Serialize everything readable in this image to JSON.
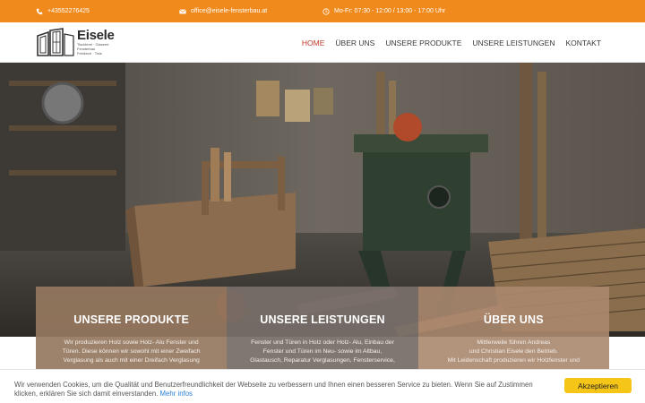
{
  "topbar": {
    "phone": "+43552276425",
    "email": "office@eisele-fensterbau.at",
    "hours": "Mo-Fr: 07:30 - 12:00 / 13:00 - 17:00 Uhr",
    "icons": [
      "phone-icon",
      "mail-icon",
      "clock-icon"
    ],
    "color": "#f08a1c"
  },
  "header": {
    "logo": {
      "name": "Eisele",
      "sub": [
        "Tischlerei · Glaserei",
        "Fensterbau",
        "Feldkirch · Tisis"
      ]
    },
    "nav": [
      {
        "label": "HOME",
        "active": true
      },
      {
        "label": "ÜBER UNS"
      },
      {
        "label": "UNSERE PRODUKTE"
      },
      {
        "label": "UNSERE LEISTUNGEN"
      },
      {
        "label": "KONTAKT"
      }
    ],
    "active_color": "#c0392b"
  },
  "boxes": [
    {
      "title": "UNSERE PRODUKTE",
      "lines": [
        "Wir produzieren Holz sowie Holz- Alu Fenster und",
        "Türen. Diese können wir sowohl mit einer Zweifach",
        "Verglasung als auch mit einer Dreifach Verglasung"
      ]
    },
    {
      "title": "UNSERE LEISTUNGEN",
      "lines": [
        "Fenster und Türen in Holz oder Holz- Alu, Einbau der",
        "Fenster und Türen im Neu- sowie im Altbau,",
        "Glastausch, Reparatur Verglasungen, Fensterservice,"
      ]
    },
    {
      "title": "ÜBER UNS",
      "lines": [
        "Mittlerweile führen Andreas",
        "und Christian Eisele den Betrieb.",
        "Mit Leidenschaft produzieren wir Holzfenster und"
      ]
    }
  ],
  "cookie": {
    "text": "Wir verwenden Cookies, um die Qualität und Benutzerfreundlichkeit der Webseite zu verbessern und Ihnen einen besseren Service zu bieten. Wenn Sie auf Zustimmen klicken, erklären Sie sich damit einverstanden.",
    "link": "Mehr infos",
    "button": "Akzeptieren",
    "button_color": "#f5c518"
  }
}
